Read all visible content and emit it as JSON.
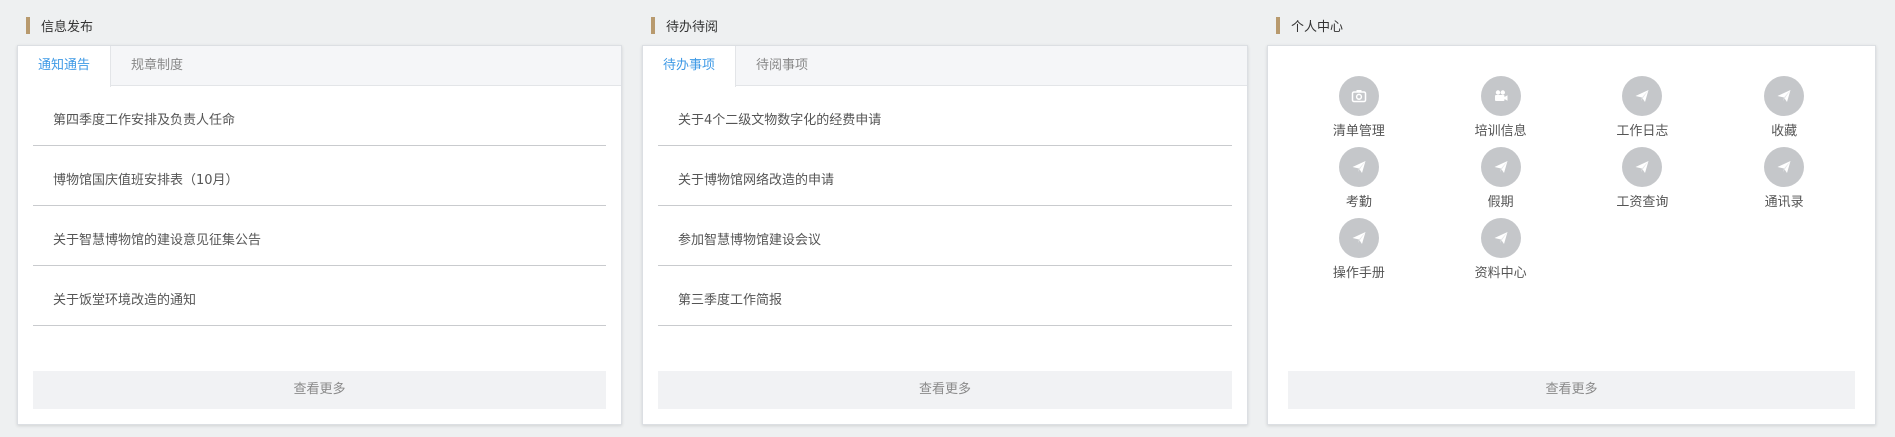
{
  "info": {
    "title": "信息发布",
    "tabs": [
      "通知通告",
      "规章制度"
    ],
    "items": [
      "第四季度工作安排及负责人任命",
      "博物馆国庆值班安排表（10月）",
      "关于智慧博物馆的建设意见征集公告",
      "关于饭堂环境改造的通知"
    ],
    "more": "查看更多"
  },
  "todo": {
    "title": "待办待阅",
    "tabs": [
      "待办事项",
      "待阅事项"
    ],
    "items": [
      "关于4个二级文物数字化的经费申请",
      "关于博物馆网络改造的申请",
      "参加智慧博物馆建设会议",
      "第三季度工作简报"
    ],
    "more": "查看更多"
  },
  "personal": {
    "title": "个人中心",
    "items": [
      {
        "label": "清单管理",
        "icon": "camera-icon"
      },
      {
        "label": "培训信息",
        "icon": "video-camera-icon"
      },
      {
        "label": "工作日志",
        "icon": "send-icon"
      },
      {
        "label": "收藏",
        "icon": "send-icon"
      },
      {
        "label": "考勤",
        "icon": "send-icon"
      },
      {
        "label": "假期",
        "icon": "send-icon"
      },
      {
        "label": "工资查询",
        "icon": "send-icon"
      },
      {
        "label": "通讯录",
        "icon": "send-icon"
      },
      {
        "label": "操作手册",
        "icon": "send-icon"
      },
      {
        "label": "资料中心",
        "icon": "send-icon"
      }
    ],
    "more": "查看更多"
  },
  "colors": {
    "accent": "#3f9ae6",
    "section_bar": "#b89a6e",
    "icon_bg": "#c5c7ca"
  }
}
